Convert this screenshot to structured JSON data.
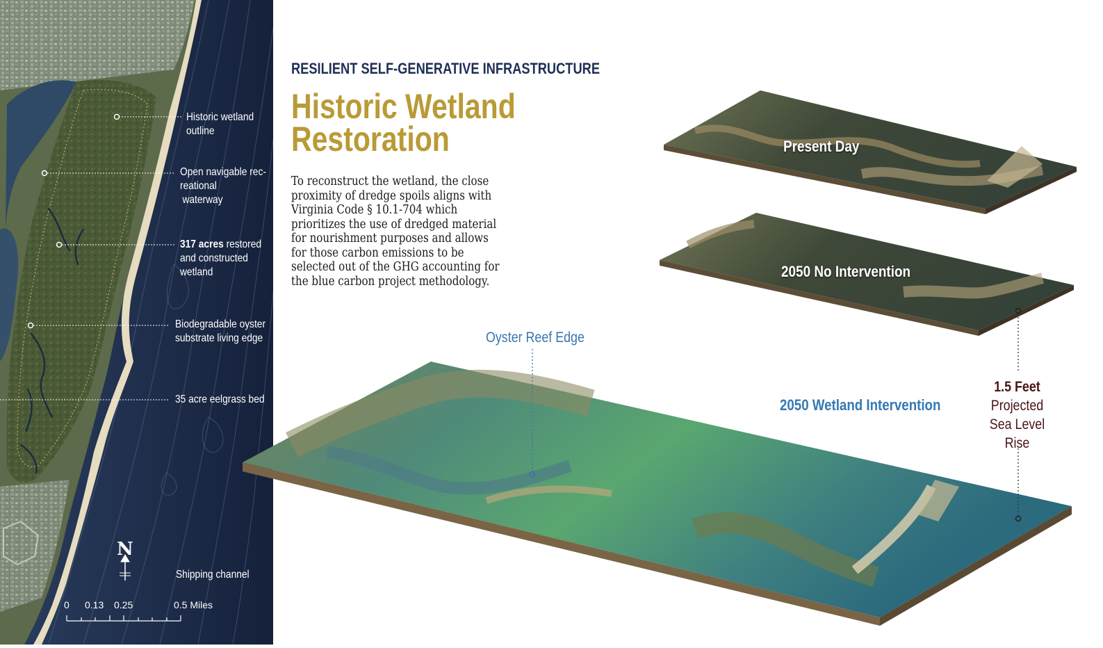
{
  "header": {
    "eyebrow": "RESILIENT SELF-GENERATIVE INFRASTRUCTURE",
    "title_line1": "Historic Wetland",
    "title_line2": "Restoration"
  },
  "body_text": {
    "lines": [
      "To reconstruct the wetland,  the close",
      "proximity of dredge spoils aligns with",
      "Virginia Code § 10.1-704 which",
      "prioritizes the use of dredged material",
      "for  nourishment purposes and allows",
      "for those carbon emissions to be",
      "selected out of the GHG accounting for",
      "the blue carbon project methodology."
    ]
  },
  "map": {
    "labels": {
      "historic_wetland": [
        "Historic wetland",
        "outline"
      ],
      "waterway": [
        "Open navigable rec-",
        "reational",
        "waterway"
      ],
      "acres_bold": "317 acres",
      "acres_rest": " restored",
      "acres_line2": "and constructed",
      "acres_line3": "wetland",
      "oyster_substrate": [
        "Biodegradable oyster",
        "substrate living edge"
      ],
      "eelgrass": "35 acre eelgrass bed",
      "shipping": "Shipping channel"
    },
    "north": "N",
    "scale": {
      "ticks": [
        "0",
        "0.13",
        "0.25",
        "0.5 Miles"
      ]
    },
    "colors": {
      "ocean": "#1b2a4a",
      "land": "#5f6f4a",
      "wetland": "#4a5c33",
      "beach": "#e8e0c8"
    }
  },
  "diagram": {
    "slabs": {
      "present_day": "Present Day",
      "no_intervention": "2050 No Intervention",
      "wetland_intervention": "2050 Wetland Intervention"
    },
    "callouts": {
      "oyster_reef_edge": "Oyster Reef Edge",
      "slr_value": "1.5 Feet",
      "slr_lines": [
        "Projected",
        "Sea Level",
        "Rise"
      ]
    },
    "colors": {
      "title_gold": "#b99a36",
      "navy": "#1d2f55",
      "accent_blue": "#3578b5",
      "slr_maroon": "#4a1414"
    }
  }
}
